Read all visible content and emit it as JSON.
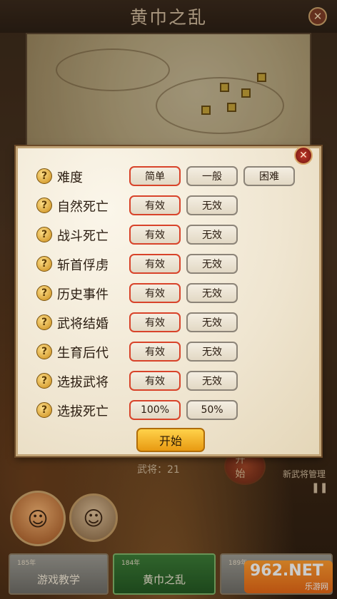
{
  "header": {
    "title": "黄巾之乱",
    "close_glyph": "✕"
  },
  "background": {
    "general_count": "武将：21",
    "start_circle_label": "开始",
    "new_general_label": "新武将管理",
    "pause_glyph": "❚❚",
    "hero_left_face": "☺",
    "hero_right_face": "☺"
  },
  "scenarios": [
    {
      "year": "185年",
      "name": "游戏教学"
    },
    {
      "year": "184年",
      "name": "黄巾之乱"
    },
    {
      "year": "189年",
      "name": ""
    }
  ],
  "watermark": {
    "big": "962.NET",
    "small": "乐游网"
  },
  "dialog": {
    "close_glyph": "✕",
    "hint_glyph": "?",
    "rows": [
      {
        "label": "难度",
        "options": [
          "简单",
          "一般",
          "困难"
        ],
        "selected": 0
      },
      {
        "label": "自然死亡",
        "options": [
          "有效",
          "无效"
        ],
        "selected": 0
      },
      {
        "label": "战斗死亡",
        "options": [
          "有效",
          "无效"
        ],
        "selected": 0
      },
      {
        "label": "斩首俘虏",
        "options": [
          "有效",
          "无效"
        ],
        "selected": 0
      },
      {
        "label": "历史事件",
        "options": [
          "有效",
          "无效"
        ],
        "selected": 0
      },
      {
        "label": "武将结婚",
        "options": [
          "有效",
          "无效"
        ],
        "selected": 0
      },
      {
        "label": "生育后代",
        "options": [
          "有效",
          "无效"
        ],
        "selected": 0
      },
      {
        "label": "选拔武将",
        "options": [
          "有效",
          "无效"
        ],
        "selected": 0
      },
      {
        "label": "选拔死亡",
        "options": [
          "100%",
          "50%"
        ],
        "selected": 0
      }
    ],
    "start_label": "开始"
  },
  "colors": {
    "selected_border": "#d8432a",
    "start_button": "#ffd24a",
    "active_tab": "#3b7a36"
  }
}
